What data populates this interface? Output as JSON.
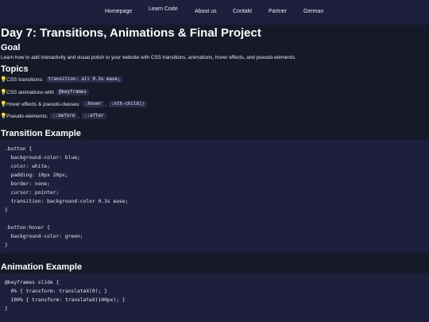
{
  "nav": {
    "items": [
      "Homepage",
      "Learn Code",
      "About us",
      "Contakt",
      "Partner",
      "German"
    ]
  },
  "page": {
    "title": "Day 7: Transitions, Animations & Final Project"
  },
  "goal": {
    "heading": "Goal",
    "text": "Learn how to add interactivity and visual polish to your website with CSS transitions, animations, hover effects, and pseudo-elements."
  },
  "topics": {
    "heading": "Topics",
    "items": [
      {
        "text": "CSS transitions:",
        "codes": [
          "transition: all 0.3s ease;"
        ]
      },
      {
        "text": "CSS animations with",
        "codes": [
          "@keyframes"
        ]
      },
      {
        "text": "Hover effects & pseudo-classes:",
        "codes": [
          ":hover",
          ":nth-child()"
        ]
      },
      {
        "text": "Pseudo-elements:",
        "codes": [
          "::before",
          "::after"
        ]
      }
    ],
    "separator": ","
  },
  "transition_example": {
    "heading": "Transition Example",
    "code": [
      ".button {",
      "  background-color: blue;",
      "  color: white;",
      "  padding: 10px 20px;",
      "  border: none;",
      "  cursor: pointer;",
      "  transition: background-color 0.3s ease;",
      "}",
      "",
      ".button:hover {",
      "  background-color: green;",
      "}"
    ]
  },
  "animation_example": {
    "heading": "Animation Example",
    "code": [
      "@keyframes slide {",
      "  0% { transform: translateX(0); }",
      "  100% { transform: translateX(100px); }",
      "}"
    ]
  },
  "colors": {
    "background": "#161a28",
    "navbar": "#1d1f3d",
    "code_block": "#1d1f3d",
    "inline_code": "#2a2c48",
    "bulb": "#f4c430"
  },
  "icons": {
    "topic_bullet": "lightbulb-icon"
  }
}
